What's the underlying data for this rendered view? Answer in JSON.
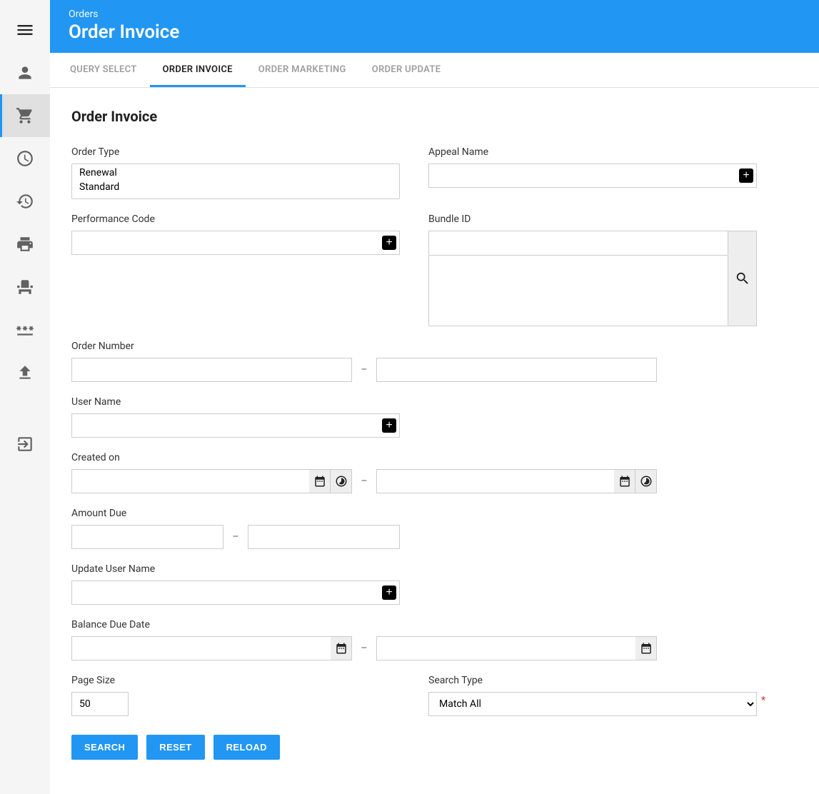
{
  "header": {
    "crumb": "Orders",
    "title": "Order Invoice"
  },
  "tabs": [
    {
      "label": "QUERY SELECT",
      "active": false
    },
    {
      "label": "ORDER INVOICE",
      "active": true
    },
    {
      "label": "ORDER MARKETING",
      "active": false
    },
    {
      "label": "ORDER UPDATE",
      "active": false
    }
  ],
  "page_title": "Order Invoice",
  "labels": {
    "order_type": "Order Type",
    "appeal_name": "Appeal Name",
    "performance_code": "Performance Code",
    "bundle_id": "Bundle ID",
    "order_number": "Order Number",
    "user_name": "User Name",
    "created_on": "Created on",
    "amount_due": "Amount Due",
    "update_user_name": "Update User Name",
    "balance_due_date": "Balance Due Date",
    "page_size": "Page Size",
    "search_type": "Search Type"
  },
  "order_type_options": [
    "Renewal",
    "Standard"
  ],
  "page_size_value": "50",
  "search_type_value": "Match All",
  "search_type_options": [
    "Match All"
  ],
  "range_separator": "–",
  "buttons": {
    "search": "SEARCH",
    "reset": "RESET",
    "reload": "RELOAD"
  },
  "required_mark": "*"
}
